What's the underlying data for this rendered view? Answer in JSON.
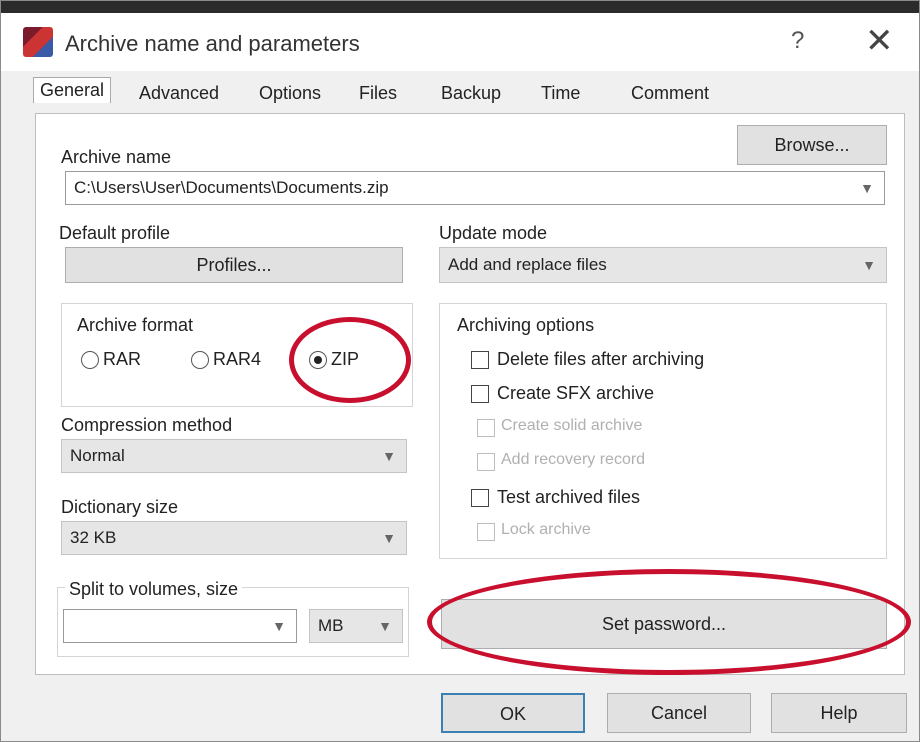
{
  "window": {
    "title": "Archive name and parameters",
    "help_glyph": "?",
    "close_glyph": "✕"
  },
  "tabs": [
    {
      "label": "General"
    },
    {
      "label": "Advanced"
    },
    {
      "label": "Options"
    },
    {
      "label": "Files"
    },
    {
      "label": "Backup"
    },
    {
      "label": "Time"
    },
    {
      "label": "Comment"
    }
  ],
  "general": {
    "archive_name_label": "Archive name",
    "archive_name_value": "C:\\Users\\User\\Documents\\Documents.zip",
    "browse_button": "Browse...",
    "default_profile_label": "Default profile",
    "profiles_button": "Profiles...",
    "update_mode_label": "Update mode",
    "update_mode_value": "Add and replace files",
    "archive_format_label": "Archive format",
    "formats": [
      {
        "label": "RAR",
        "selected": false
      },
      {
        "label": "RAR4",
        "selected": false
      },
      {
        "label": "ZIP",
        "selected": true
      }
    ],
    "compression_method_label": "Compression method",
    "compression_method_value": "Normal",
    "dictionary_size_label": "Dictionary size",
    "dictionary_size_value": "32 KB",
    "split_label": "Split to volumes, size",
    "split_value": "",
    "split_unit": "MB",
    "archiving_options_label": "Archiving options",
    "options": [
      {
        "label": "Delete files after archiving",
        "enabled": true,
        "checked": false
      },
      {
        "label": "Create SFX archive",
        "enabled": true,
        "checked": false
      },
      {
        "label": "Create solid archive",
        "enabled": false,
        "checked": false
      },
      {
        "label": "Add recovery record",
        "enabled": false,
        "checked": false
      },
      {
        "label": "Test archived files",
        "enabled": true,
        "checked": false
      },
      {
        "label": "Lock archive",
        "enabled": false,
        "checked": false
      }
    ],
    "set_password_button": "Set password..."
  },
  "footer": {
    "ok": "OK",
    "cancel": "Cancel",
    "help": "Help"
  },
  "highlight_color": "#c8102e"
}
